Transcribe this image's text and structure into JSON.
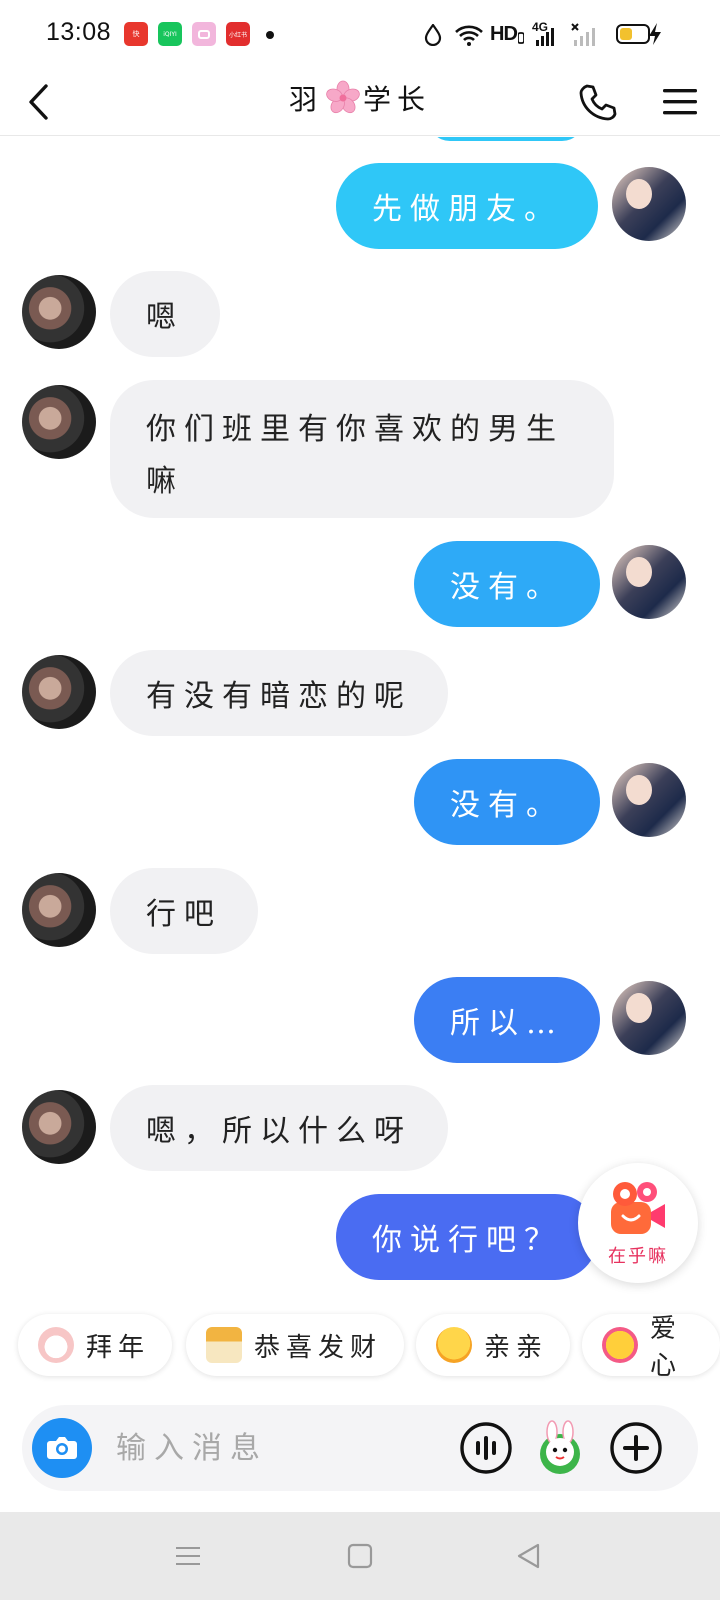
{
  "status_bar": {
    "time": "13:08",
    "apps": [
      {
        "name": "kuaishou-icon",
        "color": "#e8372d",
        "label": "快"
      },
      {
        "name": "iqiyi-icon",
        "color": "#18c55c",
        "label": "iQIYI"
      },
      {
        "name": "camera-app-icon",
        "color": "#f2b6dc",
        "label": ""
      },
      {
        "name": "xiaohongshu-icon",
        "color": "#e22e2e",
        "label": "小红书"
      }
    ],
    "network_label": "HD",
    "cellular_label": "4G",
    "battery_percent": 45
  },
  "header": {
    "title_left": "羽",
    "title_right": "学长"
  },
  "messages": [
    {
      "side": "out",
      "text": "先做朋友。",
      "color": "#2fc7f7"
    },
    {
      "side": "in",
      "text": "嗯"
    },
    {
      "side": "in",
      "text": "你们班里有你喜欢的男生嘛"
    },
    {
      "side": "out",
      "text": "没有。",
      "color": "#2eaaf7"
    },
    {
      "side": "in",
      "text": "有没有暗恋的呢"
    },
    {
      "side": "out",
      "text": "没有。",
      "color": "#2f94f5"
    },
    {
      "side": "in",
      "text": "行吧"
    },
    {
      "side": "out",
      "text": "所以…",
      "color": "#3b7ef3"
    },
    {
      "side": "in",
      "text": "嗯，所以什么呀"
    },
    {
      "side": "out",
      "text": "你说行吧？",
      "color": "#4a6cf2"
    }
  ],
  "floating_badge": {
    "label": "在乎嘛"
  },
  "quick_chips": [
    {
      "label": "拜年",
      "icon": "rabbit-icon",
      "color": "#f7c6c6"
    },
    {
      "label": "恭喜发财",
      "icon": "red-envelope-icon",
      "color": "#f2b441"
    },
    {
      "label": "亲亲",
      "icon": "hug-emoji-icon",
      "color": "#f6c324"
    },
    {
      "label": "爱心",
      "icon": "heart-eyes-emoji-icon",
      "color": "#f45a86"
    }
  ],
  "input": {
    "placeholder": "输入消息"
  },
  "colors": {
    "incoming_bubble": "#f1f1f3",
    "camera_button": "#1e8ff3",
    "nav_bar": "#e9e9e9"
  }
}
